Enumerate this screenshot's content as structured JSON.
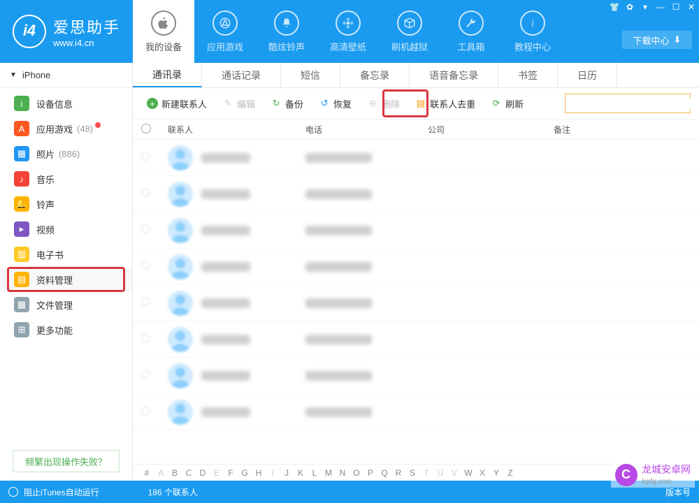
{
  "brand": {
    "name": "爱思助手",
    "url": "www.i4.cn",
    "logo_char": "i4"
  },
  "win_icons": [
    "shirt-icon",
    "gear-icon",
    "skin-icon",
    "minimize-icon",
    "maximize-icon",
    "close-icon"
  ],
  "download_center": "下载中心",
  "topnav": [
    {
      "label": "我的设备",
      "icon": "apple-icon"
    },
    {
      "label": "应用游戏",
      "icon": "appstore-icon"
    },
    {
      "label": "酷炫铃声",
      "icon": "bell-icon"
    },
    {
      "label": "高清壁纸",
      "icon": "flower-icon"
    },
    {
      "label": "刷机越狱",
      "icon": "box-icon"
    },
    {
      "label": "工具箱",
      "icon": "wrench-icon"
    },
    {
      "label": "教程中心",
      "icon": "info-icon"
    }
  ],
  "device_name": "iPhone",
  "sidebar": [
    {
      "label": "设备信息",
      "icon": "info",
      "color": "#4caf50"
    },
    {
      "label": "应用游戏",
      "icon": "app",
      "color": "#ff5722",
      "count": "(48)",
      "dot": true
    },
    {
      "label": "照片",
      "icon": "photo",
      "color": "#2196f3",
      "count": "(886)"
    },
    {
      "label": "音乐",
      "icon": "music",
      "color": "#f44336"
    },
    {
      "label": "铃声",
      "icon": "ring",
      "color": "#ffb300"
    },
    {
      "label": "视频",
      "icon": "video",
      "color": "#7e57c2"
    },
    {
      "label": "电子书",
      "icon": "book",
      "color": "#ffca28"
    },
    {
      "label": "资料管理",
      "icon": "data",
      "color": "#ffb300",
      "selected": true
    },
    {
      "label": "文件管理",
      "icon": "file",
      "color": "#90a4ae"
    },
    {
      "label": "更多功能",
      "icon": "more",
      "color": "#90a4ae"
    }
  ],
  "help_link": "频繁出现操作失败？",
  "tabs": [
    "通讯录",
    "通话记录",
    "短信",
    "备忘录",
    "语音备忘录",
    "书签",
    "日历"
  ],
  "toolbar": {
    "new_contact": "新建联系人",
    "edit": "编辑",
    "backup": "备份",
    "restore": "恢复",
    "delete": "删除",
    "dedupe": "联系人去重",
    "refresh": "刷新"
  },
  "columns": {
    "name": "联系人",
    "phone": "电话",
    "company": "公司",
    "note": "备注"
  },
  "row_count": 8,
  "az": [
    "#",
    "A",
    "B",
    "C",
    "D",
    "E",
    "F",
    "G",
    "H",
    "I",
    "J",
    "K",
    "L",
    "M",
    "N",
    "O",
    "P",
    "Q",
    "R",
    "S",
    "T",
    "U",
    "V",
    "W",
    "X",
    "Y",
    "Z"
  ],
  "az_dim": [
    "A",
    "E",
    "I",
    "T",
    "U",
    "V"
  ],
  "status": {
    "itunes": "阻止iTunes自动运行",
    "count": "186 个联系人",
    "version": "版本号"
  },
  "watermark": {
    "name": "龙城安卓网",
    "url": "lcjrfg.com"
  }
}
